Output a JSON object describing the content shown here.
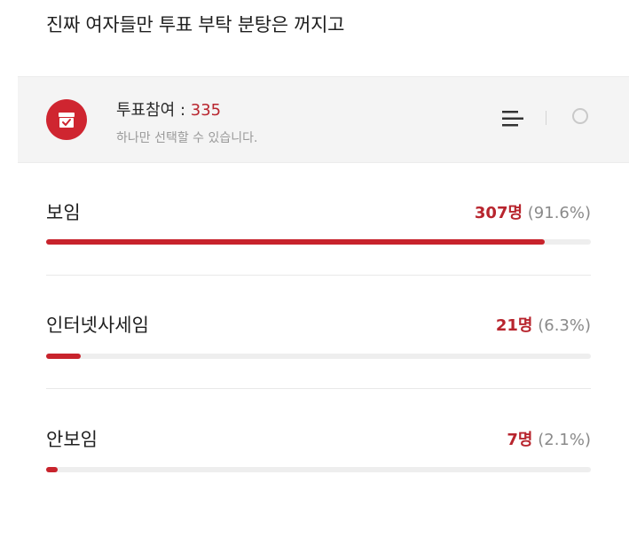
{
  "post": {
    "title": "진짜 여자들만 투표 부탁 분탕은 꺼지고"
  },
  "poll": {
    "participation_label": "투표참여 : ",
    "participation_count": "335",
    "hint": "하나만 선택할 수 있습니다.",
    "icons": {
      "poll": "ballot-box-icon",
      "sort": "sort-lines-icon",
      "select": "radio-circle-icon"
    },
    "accent_color": "#c8232c",
    "options": [
      {
        "label": "보임",
        "votes": "307명",
        "percent_text": "(91.6%)",
        "fraction": 0.916
      },
      {
        "label": "인터넷사세임",
        "votes": "21명",
        "percent_text": "(6.3%)",
        "fraction": 0.063
      },
      {
        "label": "안보임",
        "votes": "7명",
        "percent_text": "(2.1%)",
        "fraction": 0.021
      }
    ]
  }
}
